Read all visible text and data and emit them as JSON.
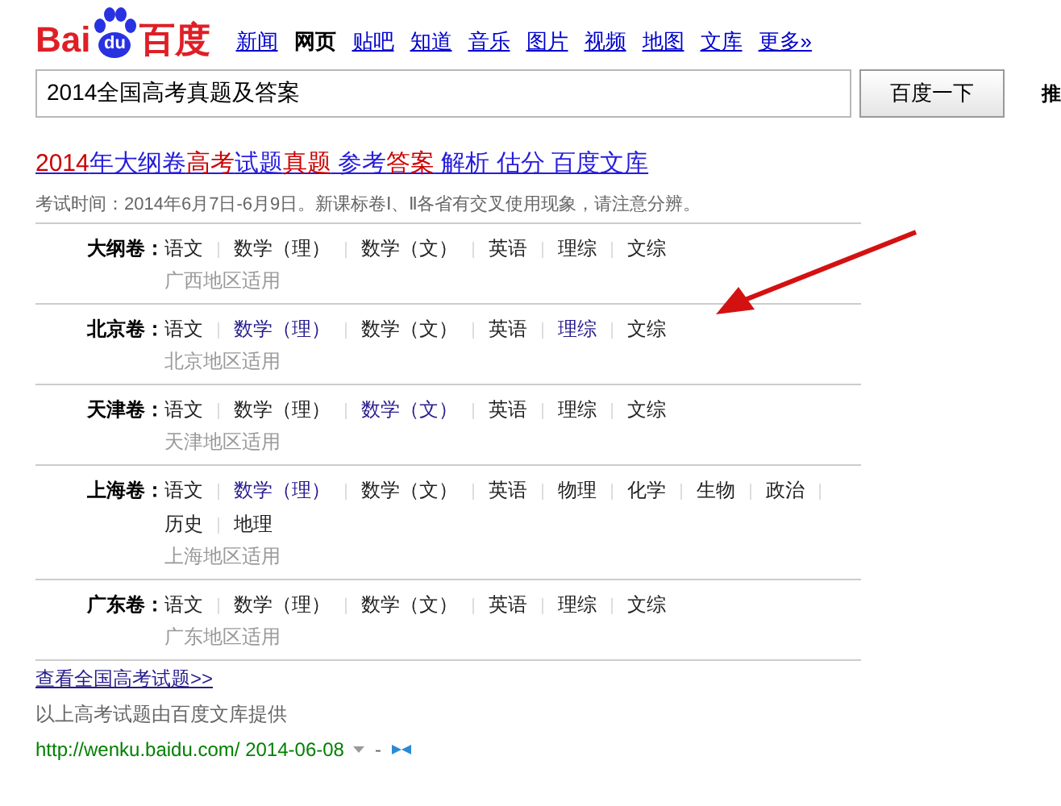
{
  "logo": {
    "left": "Bai",
    "paw": "du",
    "right": "百度"
  },
  "nav": [
    {
      "label": "新闻",
      "selected": false
    },
    {
      "label": "网页",
      "selected": true
    },
    {
      "label": "贴吧",
      "selected": false
    },
    {
      "label": "知道",
      "selected": false
    },
    {
      "label": "音乐",
      "selected": false
    },
    {
      "label": "图片",
      "selected": false
    },
    {
      "label": "视频",
      "selected": false
    },
    {
      "label": "地图",
      "selected": false
    },
    {
      "label": "文库",
      "selected": false
    },
    {
      "label": "更多»",
      "selected": false
    }
  ],
  "search": {
    "value": "2014全国高考真题及答案",
    "button": "百度一下",
    "side_link": "推"
  },
  "result": {
    "title": [
      {
        "text": "2014",
        "highlight": true
      },
      {
        "text": "年大纲卷",
        "highlight": false
      },
      {
        "text": "高考",
        "highlight": true
      },
      {
        "text": "试题",
        "highlight": false
      },
      {
        "text": "真题",
        "highlight": true
      },
      {
        "text": " 参考",
        "highlight": false
      },
      {
        "text": "答案",
        "highlight": true
      },
      {
        "text": " 解析 估分 百度文库",
        "highlight": false
      }
    ],
    "info": "考试时间：2014年6月7日-6月9日。新课标卷Ⅰ、Ⅱ各省有交叉使用现象，请注意分辨。",
    "sections": [
      {
        "label": "大纲卷：",
        "note": "广西地区适用",
        "links": [
          {
            "text": "语文",
            "visited": false
          },
          {
            "text": "数学（理）",
            "visited": false
          },
          {
            "text": "数学（文）",
            "visited": false
          },
          {
            "text": "英语",
            "visited": false
          },
          {
            "text": "理综",
            "visited": false
          },
          {
            "text": "文综",
            "visited": false
          }
        ]
      },
      {
        "label": "北京卷：",
        "note": "北京地区适用",
        "links": [
          {
            "text": "语文",
            "visited": false
          },
          {
            "text": "数学（理）",
            "visited": true
          },
          {
            "text": "数学（文）",
            "visited": false
          },
          {
            "text": "英语",
            "visited": false
          },
          {
            "text": "理综",
            "visited": true
          },
          {
            "text": "文综",
            "visited": false
          }
        ]
      },
      {
        "label": "天津卷：",
        "note": "天津地区适用",
        "links": [
          {
            "text": "语文",
            "visited": false
          },
          {
            "text": "数学（理）",
            "visited": false
          },
          {
            "text": "数学（文）",
            "visited": true
          },
          {
            "text": "英语",
            "visited": false
          },
          {
            "text": "理综",
            "visited": false
          },
          {
            "text": "文综",
            "visited": false
          }
        ]
      },
      {
        "label": "上海卷：",
        "note": "上海地区适用",
        "links": [
          {
            "text": "语文",
            "visited": false
          },
          {
            "text": "数学（理）",
            "visited": true
          },
          {
            "text": "数学（文）",
            "visited": false
          },
          {
            "text": "英语",
            "visited": false
          },
          {
            "text": "物理",
            "visited": false
          },
          {
            "text": "化学",
            "visited": false
          },
          {
            "text": "生物",
            "visited": false
          },
          {
            "text": "政治",
            "visited": false
          },
          {
            "text": "历史",
            "visited": false
          },
          {
            "text": "地理",
            "visited": false
          }
        ]
      },
      {
        "label": "广东卷：",
        "note": "广东地区适用",
        "links": [
          {
            "text": "语文",
            "visited": false
          },
          {
            "text": "数学（理）",
            "visited": false
          },
          {
            "text": "数学（文）",
            "visited": false
          },
          {
            "text": "英语",
            "visited": false
          },
          {
            "text": "理综",
            "visited": false
          },
          {
            "text": "文综",
            "visited": false
          }
        ]
      }
    ],
    "more_link": "查看全国高考试题>>",
    "source": "以上高考试题由百度文库提供",
    "url": "http://wenku.baidu.com/ 2014-06-08",
    "separator": "-"
  }
}
